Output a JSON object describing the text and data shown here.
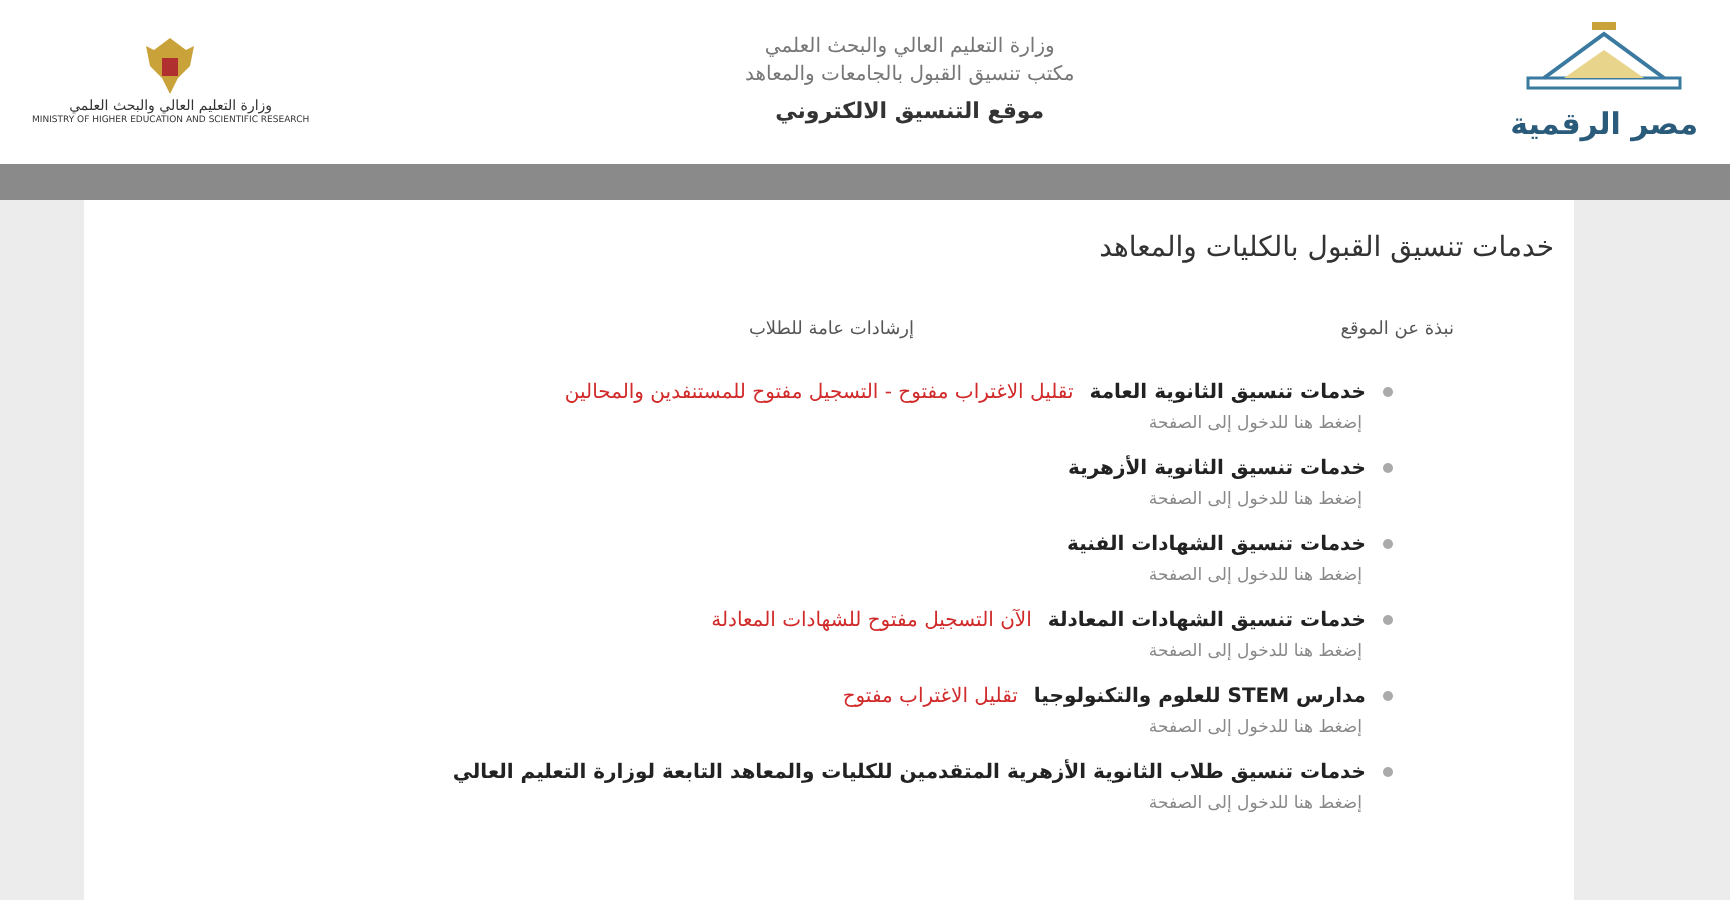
{
  "header": {
    "ministry_logo": {
      "caption": "وزارة التعليم العالي والبحث العلمي",
      "caption_en": "MINISTRY OF HIGHER EDUCATION AND SCIENTIFIC RESEARCH"
    },
    "lines": [
      "وزارة التعليم العالي والبحث العلمي",
      "مكتب تنسيق القبول بالجامعات والمعاهد"
    ],
    "site_title": "موقع التنسيق الالكتروني",
    "brand": "مصر الرقمية"
  },
  "page_title": "خدمات تنسيق القبول بالكليات والمعاهد",
  "links": [
    {
      "label": "نبذة عن الموقع"
    },
    {
      "label": "إرشادات عامة للطلاب"
    }
  ],
  "services": [
    {
      "title": "خدمات تنسيق الثانوية العامة",
      "notice": "تقليل الاغتراب مفتوح - التسجيل مفتوح للمستنفدين والمحالين",
      "hint": "إضغط هنا للدخول إلى الصفحة"
    },
    {
      "title": "خدمات تنسيق الثانوية الأزهرية",
      "hint": "إضغط هنا للدخول إلى الصفحة"
    },
    {
      "title": "خدمات تنسيق الشهادات الفنية",
      "hint": "إضغط هنا للدخول إلى الصفحة"
    },
    {
      "title": "خدمات تنسيق الشهادات المعادلة",
      "notice": "الآن التسجيل مفتوح للشهادات المعادلة",
      "hint": "إضغط هنا للدخول إلى الصفحة"
    },
    {
      "title": "مدارس STEM للعلوم والتكنولوجيا",
      "notice": "تقليل الاغتراب مفتوح",
      "hint": "إضغط هنا للدخول إلى الصفحة"
    },
    {
      "title": "خدمات تنسيق طلاب الثانوية الأزهرية المتقدمين للكليات والمعاهد التابعة لوزارة التعليم العالي",
      "hint": "إضغط هنا للدخول إلى الصفحة"
    }
  ]
}
